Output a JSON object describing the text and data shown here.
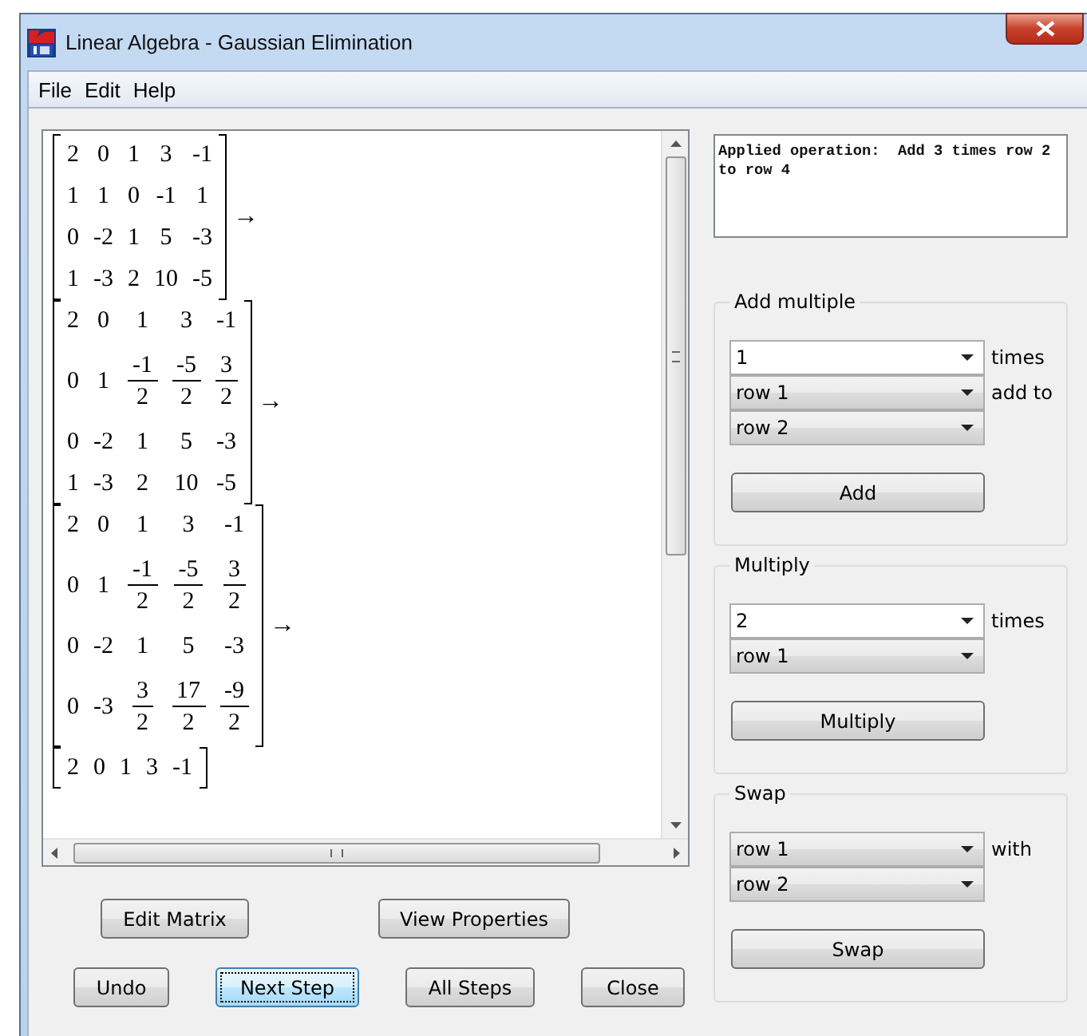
{
  "window": {
    "title": "Linear Algebra - Gaussian Elimination"
  },
  "menu": [
    "File",
    "Edit",
    "Help"
  ],
  "steps": [
    {
      "rows": [
        [
          "2",
          "0",
          "1",
          "3",
          "-1"
        ],
        [
          "1",
          "1",
          "0",
          "-1",
          "1"
        ],
        [
          "0",
          "-2",
          "1",
          "5",
          "-3"
        ],
        [
          "1",
          "-3",
          "2",
          "10",
          "-5"
        ]
      ],
      "arrow": "→"
    },
    {
      "rows": [
        [
          "2",
          "0",
          "1",
          "3",
          "-1"
        ],
        [
          "0",
          "1",
          {
            "num": "-1",
            "den": "2"
          },
          {
            "num": "-5",
            "den": "2"
          },
          {
            "num": "3",
            "den": "2"
          }
        ],
        [
          "0",
          "-2",
          "1",
          "5",
          "-3"
        ],
        [
          "1",
          "-3",
          "2",
          "10",
          "-5"
        ]
      ],
      "arrow": "→"
    },
    {
      "rows": [
        [
          "2",
          "0",
          "1",
          "3",
          "-1"
        ],
        [
          "0",
          "1",
          {
            "num": "-1",
            "den": "2"
          },
          {
            "num": "-5",
            "den": "2"
          },
          {
            "num": "3",
            "den": "2"
          }
        ],
        [
          "0",
          "-2",
          "1",
          "5",
          "-3"
        ],
        [
          "0",
          "-3",
          {
            "num": "3",
            "den": "2"
          },
          {
            "num": "17",
            "den": "2"
          },
          {
            "num": "-9",
            "den": "2"
          }
        ]
      ],
      "arrow": "→"
    },
    {
      "rows": [
        [
          "2",
          "0",
          "1",
          "3",
          "-1"
        ]
      ]
    }
  ],
  "output": "Applied operation:  Add 3 times row 2 to row 4",
  "groups": [
    {
      "title": "Add multiple",
      "fields": [
        {
          "kind": "editable",
          "value": "1",
          "suffix": "times"
        },
        {
          "kind": "list",
          "value": "row 1",
          "suffix": "add to"
        },
        {
          "kind": "list",
          "value": "row 2"
        }
      ],
      "button": "Add"
    },
    {
      "title": "Multiply",
      "fields": [
        {
          "kind": "editable",
          "value": "2",
          "suffix": "times"
        },
        {
          "kind": "list",
          "value": "row 1"
        }
      ],
      "button": "Multiply"
    },
    {
      "title": "Swap",
      "fields": [
        {
          "kind": "list",
          "value": "row 1",
          "suffix": "with"
        },
        {
          "kind": "list",
          "value": "row 2"
        }
      ],
      "button": "Swap"
    }
  ],
  "top_buttons": [
    {
      "label": "Edit Matrix"
    },
    {
      "label": "View Properties"
    }
  ],
  "bottom_buttons": [
    {
      "label": "Undo",
      "selected": false
    },
    {
      "label": "Next Step",
      "selected": true
    },
    {
      "label": "All Steps",
      "selected": false
    },
    {
      "label": "Close",
      "selected": false
    }
  ]
}
